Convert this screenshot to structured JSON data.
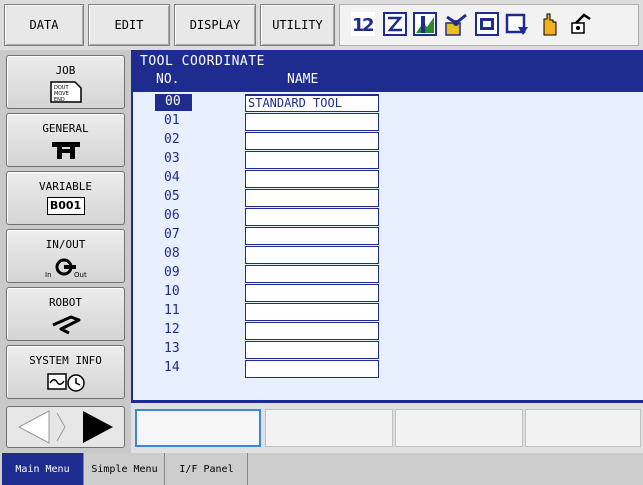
{
  "menu_bar": {
    "items": [
      {
        "label": "DATA"
      },
      {
        "label": "EDIT"
      },
      {
        "label": "DISPLAY"
      },
      {
        "label": "UTILITY"
      }
    ],
    "status_icons": [
      "mode-switch-icon",
      "edit-mode-icon",
      "chart-icon",
      "robot-arm-icon",
      "coordinate-icon",
      "frame-icon",
      "hand-icon",
      "servo-icon"
    ]
  },
  "sidebar": {
    "items": [
      {
        "label": "JOB",
        "icon": "job-document-icon",
        "icon_text": "DOUT MOVE END"
      },
      {
        "label": "GENERAL",
        "icon": "general-tool-icon"
      },
      {
        "label": "VARIABLE",
        "icon": "variable-icon",
        "icon_text": "B001"
      },
      {
        "label": "IN/OUT",
        "icon": "io-plug-icon",
        "icon_text_in": "In",
        "icon_text_out": "Out"
      },
      {
        "label": "ROBOT",
        "icon": "robot-arm-icon"
      },
      {
        "label": "SYSTEM INFO",
        "icon": "system-info-icon"
      }
    ]
  },
  "window": {
    "title": "TOOL COORDINATE",
    "col_no": "NO.",
    "col_name": "NAME",
    "rows": [
      {
        "no": "00",
        "name": "STANDARD TOOL"
      },
      {
        "no": "01",
        "name": ""
      },
      {
        "no": "02",
        "name": ""
      },
      {
        "no": "03",
        "name": ""
      },
      {
        "no": "04",
        "name": ""
      },
      {
        "no": "05",
        "name": ""
      },
      {
        "no": "06",
        "name": ""
      },
      {
        "no": "07",
        "name": ""
      },
      {
        "no": "08",
        "name": ""
      },
      {
        "no": "09",
        "name": ""
      },
      {
        "no": "10",
        "name": ""
      },
      {
        "no": "11",
        "name": ""
      },
      {
        "no": "12",
        "name": ""
      },
      {
        "no": "13",
        "name": ""
      },
      {
        "no": "14",
        "name": ""
      }
    ]
  },
  "taskbar": {
    "items": [
      {
        "label": "Main Menu"
      },
      {
        "label": "Simple Menu"
      },
      {
        "label": "I/F Panel"
      }
    ]
  },
  "colors": {
    "accent": "#1f2c8f",
    "panel": "#e8f0ff",
    "input_focus": "#3a86d8"
  }
}
